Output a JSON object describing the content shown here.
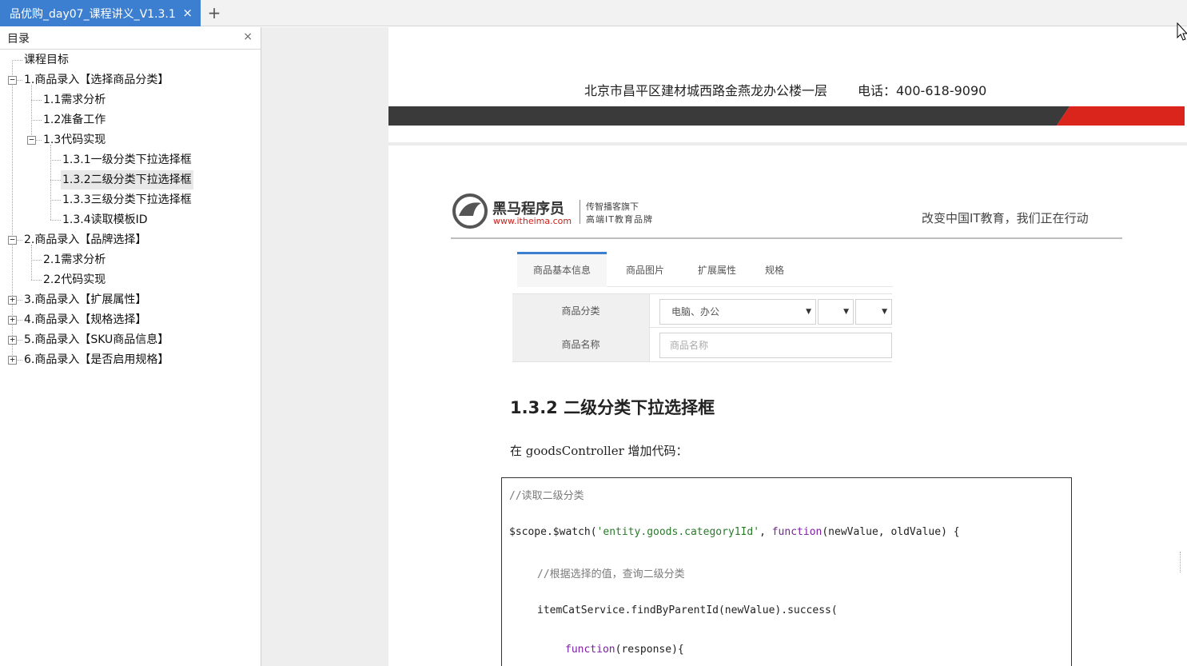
{
  "tab": {
    "title": "品优购_day07_课程讲义_V1.3.1",
    "close_glyph": "×",
    "add_glyph": "+"
  },
  "sidebar": {
    "title": "目录",
    "close_glyph": "×",
    "items": [
      {
        "label": "课程目标",
        "level": 0
      },
      {
        "label": "1.商品录入【选择商品分类】",
        "level": 0,
        "expander": "−"
      },
      {
        "label": "1.1需求分析",
        "level": 1
      },
      {
        "label": "1.2准备工作",
        "level": 1
      },
      {
        "label": "1.3代码实现",
        "level": 1,
        "expander": "−"
      },
      {
        "label": "1.3.1一级分类下拉选择框",
        "level": 2
      },
      {
        "label": "1.3.2二级分类下拉选择框",
        "level": 2,
        "selected": true
      },
      {
        "label": "1.3.3三级分类下拉选择框",
        "level": 2
      },
      {
        "label": "1.3.4读取模板ID",
        "level": 2
      },
      {
        "label": "2.商品录入【品牌选择】",
        "level": 0,
        "expander": "−"
      },
      {
        "label": "2.1需求分析",
        "level": 1
      },
      {
        "label": "2.2代码实现",
        "level": 1
      },
      {
        "label": "3.商品录入【扩展属性】",
        "level": 0,
        "expander": "+"
      },
      {
        "label": "4.商品录入【规格选择】",
        "level": 0,
        "expander": "+"
      },
      {
        "label": "5.商品录入【SKU商品信息】",
        "level": 0,
        "expander": "+"
      },
      {
        "label": "6.商品录入【是否启用规格】",
        "level": 0,
        "expander": "+"
      }
    ]
  },
  "document": {
    "header_address": "北京市昌平区建材城西路金燕龙办公楼一层",
    "header_phone": "电话：400-618-9090",
    "band_colors": {
      "dark": "#3a3a3a",
      "red": "#d9251c"
    },
    "logo": {
      "name": "黑马程序员",
      "url": "www.itheima.com",
      "tag_line1": "传智播客旗下",
      "tag_line2": "高端IT教育品牌"
    },
    "slogan": "改变中国IT教育，我们正在行动",
    "mock_tabs": [
      "商品基本信息",
      "商品图片",
      "扩展属性",
      "规格"
    ],
    "mock_form": {
      "category_label": "商品分类",
      "category_value": "电脑、办公",
      "name_label": "商品名称",
      "name_placeholder": "商品名称",
      "caret": "▼"
    },
    "heading": "1.3.2 二级分类下拉选择框",
    "paragraph": "在 goodsController 增加代码：",
    "code": {
      "line1_comment": "//读取二级分类",
      "line2_a": "$scope.$watch(",
      "line2_str": "'entity.goods.category1Id'",
      "line2_b": ", ",
      "line2_kw": "function",
      "line2_c": "(newValue, oldValue) {",
      "line3_comment": "//根据选择的值，查询二级分类",
      "line4": "itemCatService.findByParentId(newValue).success(",
      "line5_kw": "function",
      "line5_rest": "(response){"
    }
  }
}
